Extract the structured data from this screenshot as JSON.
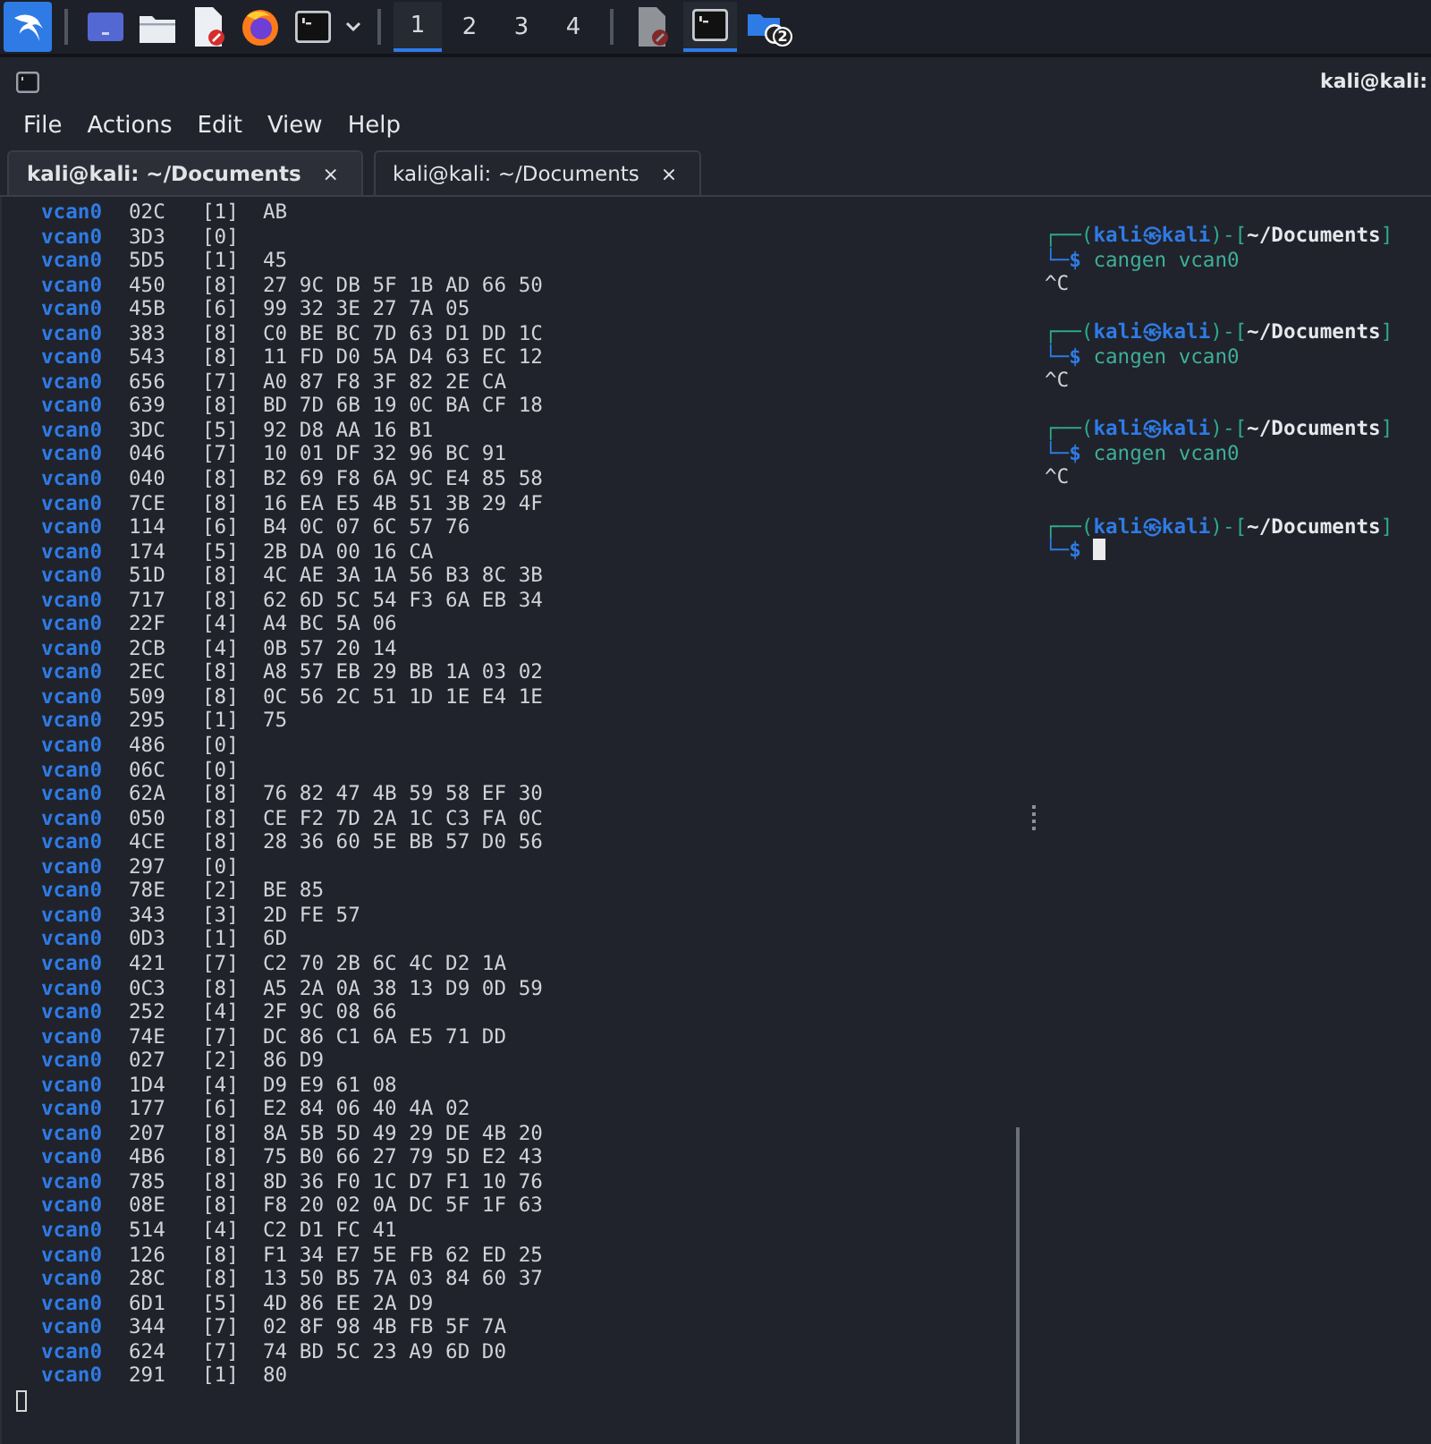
{
  "taskbar": {
    "launchers": [
      {
        "kind": "kali-menu"
      },
      {
        "kind": "desktop"
      },
      {
        "kind": "files"
      },
      {
        "kind": "editor"
      },
      {
        "kind": "browser"
      },
      {
        "kind": "terminal"
      },
      {
        "kind": "dropdown"
      }
    ],
    "workspaces": [
      {
        "label": "1",
        "selected": true
      },
      {
        "label": "2",
        "selected": false
      },
      {
        "label": "3",
        "selected": false
      },
      {
        "label": "4",
        "selected": false
      }
    ],
    "apps": [
      {
        "kind": "editor",
        "selected": false
      },
      {
        "kind": "terminal",
        "selected": true
      },
      {
        "kind": "folder",
        "selected": false,
        "badge": "2"
      }
    ]
  },
  "window": {
    "title": "kali@kali:"
  },
  "menu": [
    "File",
    "Actions",
    "Edit",
    "View",
    "Help"
  ],
  "tabs": [
    {
      "label": "kali@kali: ~/Documents",
      "close": "×",
      "selected": true
    },
    {
      "label": "kali@kali: ~/Documents",
      "close": "×",
      "selected": false
    }
  ],
  "left_pane": {
    "focused": false,
    "frames": [
      {
        "interface": "vcan0",
        "id": "02C",
        "dlc": "[1]",
        "data": "AB"
      },
      {
        "interface": "vcan0",
        "id": "3D3",
        "dlc": "[0]"
      },
      {
        "interface": "vcan0",
        "id": "5D5",
        "dlc": "[1]",
        "data": "45"
      },
      {
        "interface": "vcan0",
        "id": "450",
        "dlc": "[8]",
        "data": "27 9C DB 5F 1B AD 66 50"
      },
      {
        "interface": "vcan0",
        "id": "45B",
        "dlc": "[6]",
        "data": "99 32 3E 27 7A 05"
      },
      {
        "interface": "vcan0",
        "id": "383",
        "dlc": "[8]",
        "data": "C0 BE BC 7D 63 D1 DD 1C"
      },
      {
        "interface": "vcan0",
        "id": "543",
        "dlc": "[8]",
        "data": "11 FD D0 5A D4 63 EC 12"
      },
      {
        "interface": "vcan0",
        "id": "656",
        "dlc": "[7]",
        "data": "A0 87 F8 3F 82 2E CA"
      },
      {
        "interface": "vcan0",
        "id": "639",
        "dlc": "[8]",
        "data": "BD 7D 6B 19 0C BA CF 18"
      },
      {
        "interface": "vcan0",
        "id": "3DC",
        "dlc": "[5]",
        "data": "92 D8 AA 16 B1"
      },
      {
        "interface": "vcan0",
        "id": "046",
        "dlc": "[7]",
        "data": "10 01 DF 32 96 BC 91"
      },
      {
        "interface": "vcan0",
        "id": "040",
        "dlc": "[8]",
        "data": "B2 69 F8 6A 9C E4 85 58"
      },
      {
        "interface": "vcan0",
        "id": "7CE",
        "dlc": "[8]",
        "data": "16 EA E5 4B 51 3B 29 4F"
      },
      {
        "interface": "vcan0",
        "id": "114",
        "dlc": "[6]",
        "data": "B4 0C 07 6C 57 76"
      },
      {
        "interface": "vcan0",
        "id": "174",
        "dlc": "[5]",
        "data": "2B DA 00 16 CA"
      },
      {
        "interface": "vcan0",
        "id": "51D",
        "dlc": "[8]",
        "data": "4C AE 3A 1A 56 B3 8C 3B"
      },
      {
        "interface": "vcan0",
        "id": "717",
        "dlc": "[8]",
        "data": "62 6D 5C 54 F3 6A EB 34"
      },
      {
        "interface": "vcan0",
        "id": "22F",
        "dlc": "[4]",
        "data": "A4 BC 5A 06"
      },
      {
        "interface": "vcan0",
        "id": "2CB",
        "dlc": "[4]",
        "data": "0B 57 20 14"
      },
      {
        "interface": "vcan0",
        "id": "2EC",
        "dlc": "[8]",
        "data": "A8 57 EB 29 BB 1A 03 02"
      },
      {
        "interface": "vcan0",
        "id": "509",
        "dlc": "[8]",
        "data": "0C 56 2C 51 1D 1E E4 1E"
      },
      {
        "interface": "vcan0",
        "id": "295",
        "dlc": "[1]",
        "data": "75"
      },
      {
        "interface": "vcan0",
        "id": "486",
        "dlc": "[0]"
      },
      {
        "interface": "vcan0",
        "id": "06C",
        "dlc": "[0]"
      },
      {
        "interface": "vcan0",
        "id": "62A",
        "dlc": "[8]",
        "data": "76 82 47 4B 59 58 EF 30"
      },
      {
        "interface": "vcan0",
        "id": "050",
        "dlc": "[8]",
        "data": "CE F2 7D 2A 1C C3 FA 0C"
      },
      {
        "interface": "vcan0",
        "id": "4CE",
        "dlc": "[8]",
        "data": "28 36 60 5E BB 57 D0 56"
      },
      {
        "interface": "vcan0",
        "id": "297",
        "dlc": "[0]"
      },
      {
        "interface": "vcan0",
        "id": "78E",
        "dlc": "[2]",
        "data": "BE 85"
      },
      {
        "interface": "vcan0",
        "id": "343",
        "dlc": "[3]",
        "data": "2D FE 57"
      },
      {
        "interface": "vcan0",
        "id": "0D3",
        "dlc": "[1]",
        "data": "6D"
      },
      {
        "interface": "vcan0",
        "id": "421",
        "dlc": "[7]",
        "data": "C2 70 2B 6C 4C D2 1A"
      },
      {
        "interface": "vcan0",
        "id": "0C3",
        "dlc": "[8]",
        "data": "A5 2A 0A 38 13 D9 0D 59"
      },
      {
        "interface": "vcan0",
        "id": "252",
        "dlc": "[4]",
        "data": "2F 9C 08 66"
      },
      {
        "interface": "vcan0",
        "id": "74E",
        "dlc": "[7]",
        "data": "DC 86 C1 6A E5 71 DD"
      },
      {
        "interface": "vcan0",
        "id": "027",
        "dlc": "[2]",
        "data": "86 D9"
      },
      {
        "interface": "vcan0",
        "id": "1D4",
        "dlc": "[4]",
        "data": "D9 E9 61 08"
      },
      {
        "interface": "vcan0",
        "id": "177",
        "dlc": "[6]",
        "data": "E2 84 06 40 4A 02"
      },
      {
        "interface": "vcan0",
        "id": "207",
        "dlc": "[8]",
        "data": "8A 5B 5D 49 29 DE 4B 20"
      },
      {
        "interface": "vcan0",
        "id": "4B6",
        "dlc": "[8]",
        "data": "75 B0 66 27 79 5D E2 43"
      },
      {
        "interface": "vcan0",
        "id": "785",
        "dlc": "[8]",
        "data": "8D 36 F0 1C D7 F1 10 76"
      },
      {
        "interface": "vcan0",
        "id": "08E",
        "dlc": "[8]",
        "data": "F8 20 02 0A DC 5F 1F 63"
      },
      {
        "interface": "vcan0",
        "id": "514",
        "dlc": "[4]",
        "data": "C2 D1 FC 41"
      },
      {
        "interface": "vcan0",
        "id": "126",
        "dlc": "[8]",
        "data": "F1 34 E7 5E FB 62 ED 25"
      },
      {
        "interface": "vcan0",
        "id": "28C",
        "dlc": "[8]",
        "data": "13 50 B5 7A 03 84 60 37"
      },
      {
        "interface": "vcan0",
        "id": "6D1",
        "dlc": "[5]",
        "data": "4D 86 EE 2A D9"
      },
      {
        "interface": "vcan0",
        "id": "344",
        "dlc": "[7]",
        "data": "02 8F 98 4B FB 5F 7A"
      },
      {
        "interface": "vcan0",
        "id": "624",
        "dlc": "[7]",
        "data": "74 BD 5C 23 A9 6D D0"
      },
      {
        "interface": "vcan0",
        "id": "291",
        "dlc": "[1]",
        "data": "80"
      }
    ]
  },
  "right_pane": {
    "focused": true,
    "sessions": [
      {
        "open": "┌──(",
        "user_host": "kali㉿kali",
        "mid": ")-[",
        "dir": "~/Documents",
        "close": "]",
        "prompt": "└─$",
        "command": "cangen vcan0",
        "output": "^C"
      },
      {
        "open": "┌──(",
        "user_host": "kali㉿kali",
        "mid": ")-[",
        "dir": "~/Documents",
        "close": "]",
        "prompt": "└─$",
        "command": "cangen vcan0",
        "output": "^C"
      },
      {
        "open": "┌──(",
        "user_host": "kali㉿kali",
        "mid": ")-[",
        "dir": "~/Documents",
        "close": "]",
        "prompt": "└─$",
        "command": "cangen vcan0",
        "output": "^C"
      },
      {
        "open": "┌──(",
        "user_host": "kali㉿kali",
        "mid": ")-[",
        "dir": "~/Documents",
        "close": "]",
        "prompt": "└─$"
      }
    ]
  }
}
